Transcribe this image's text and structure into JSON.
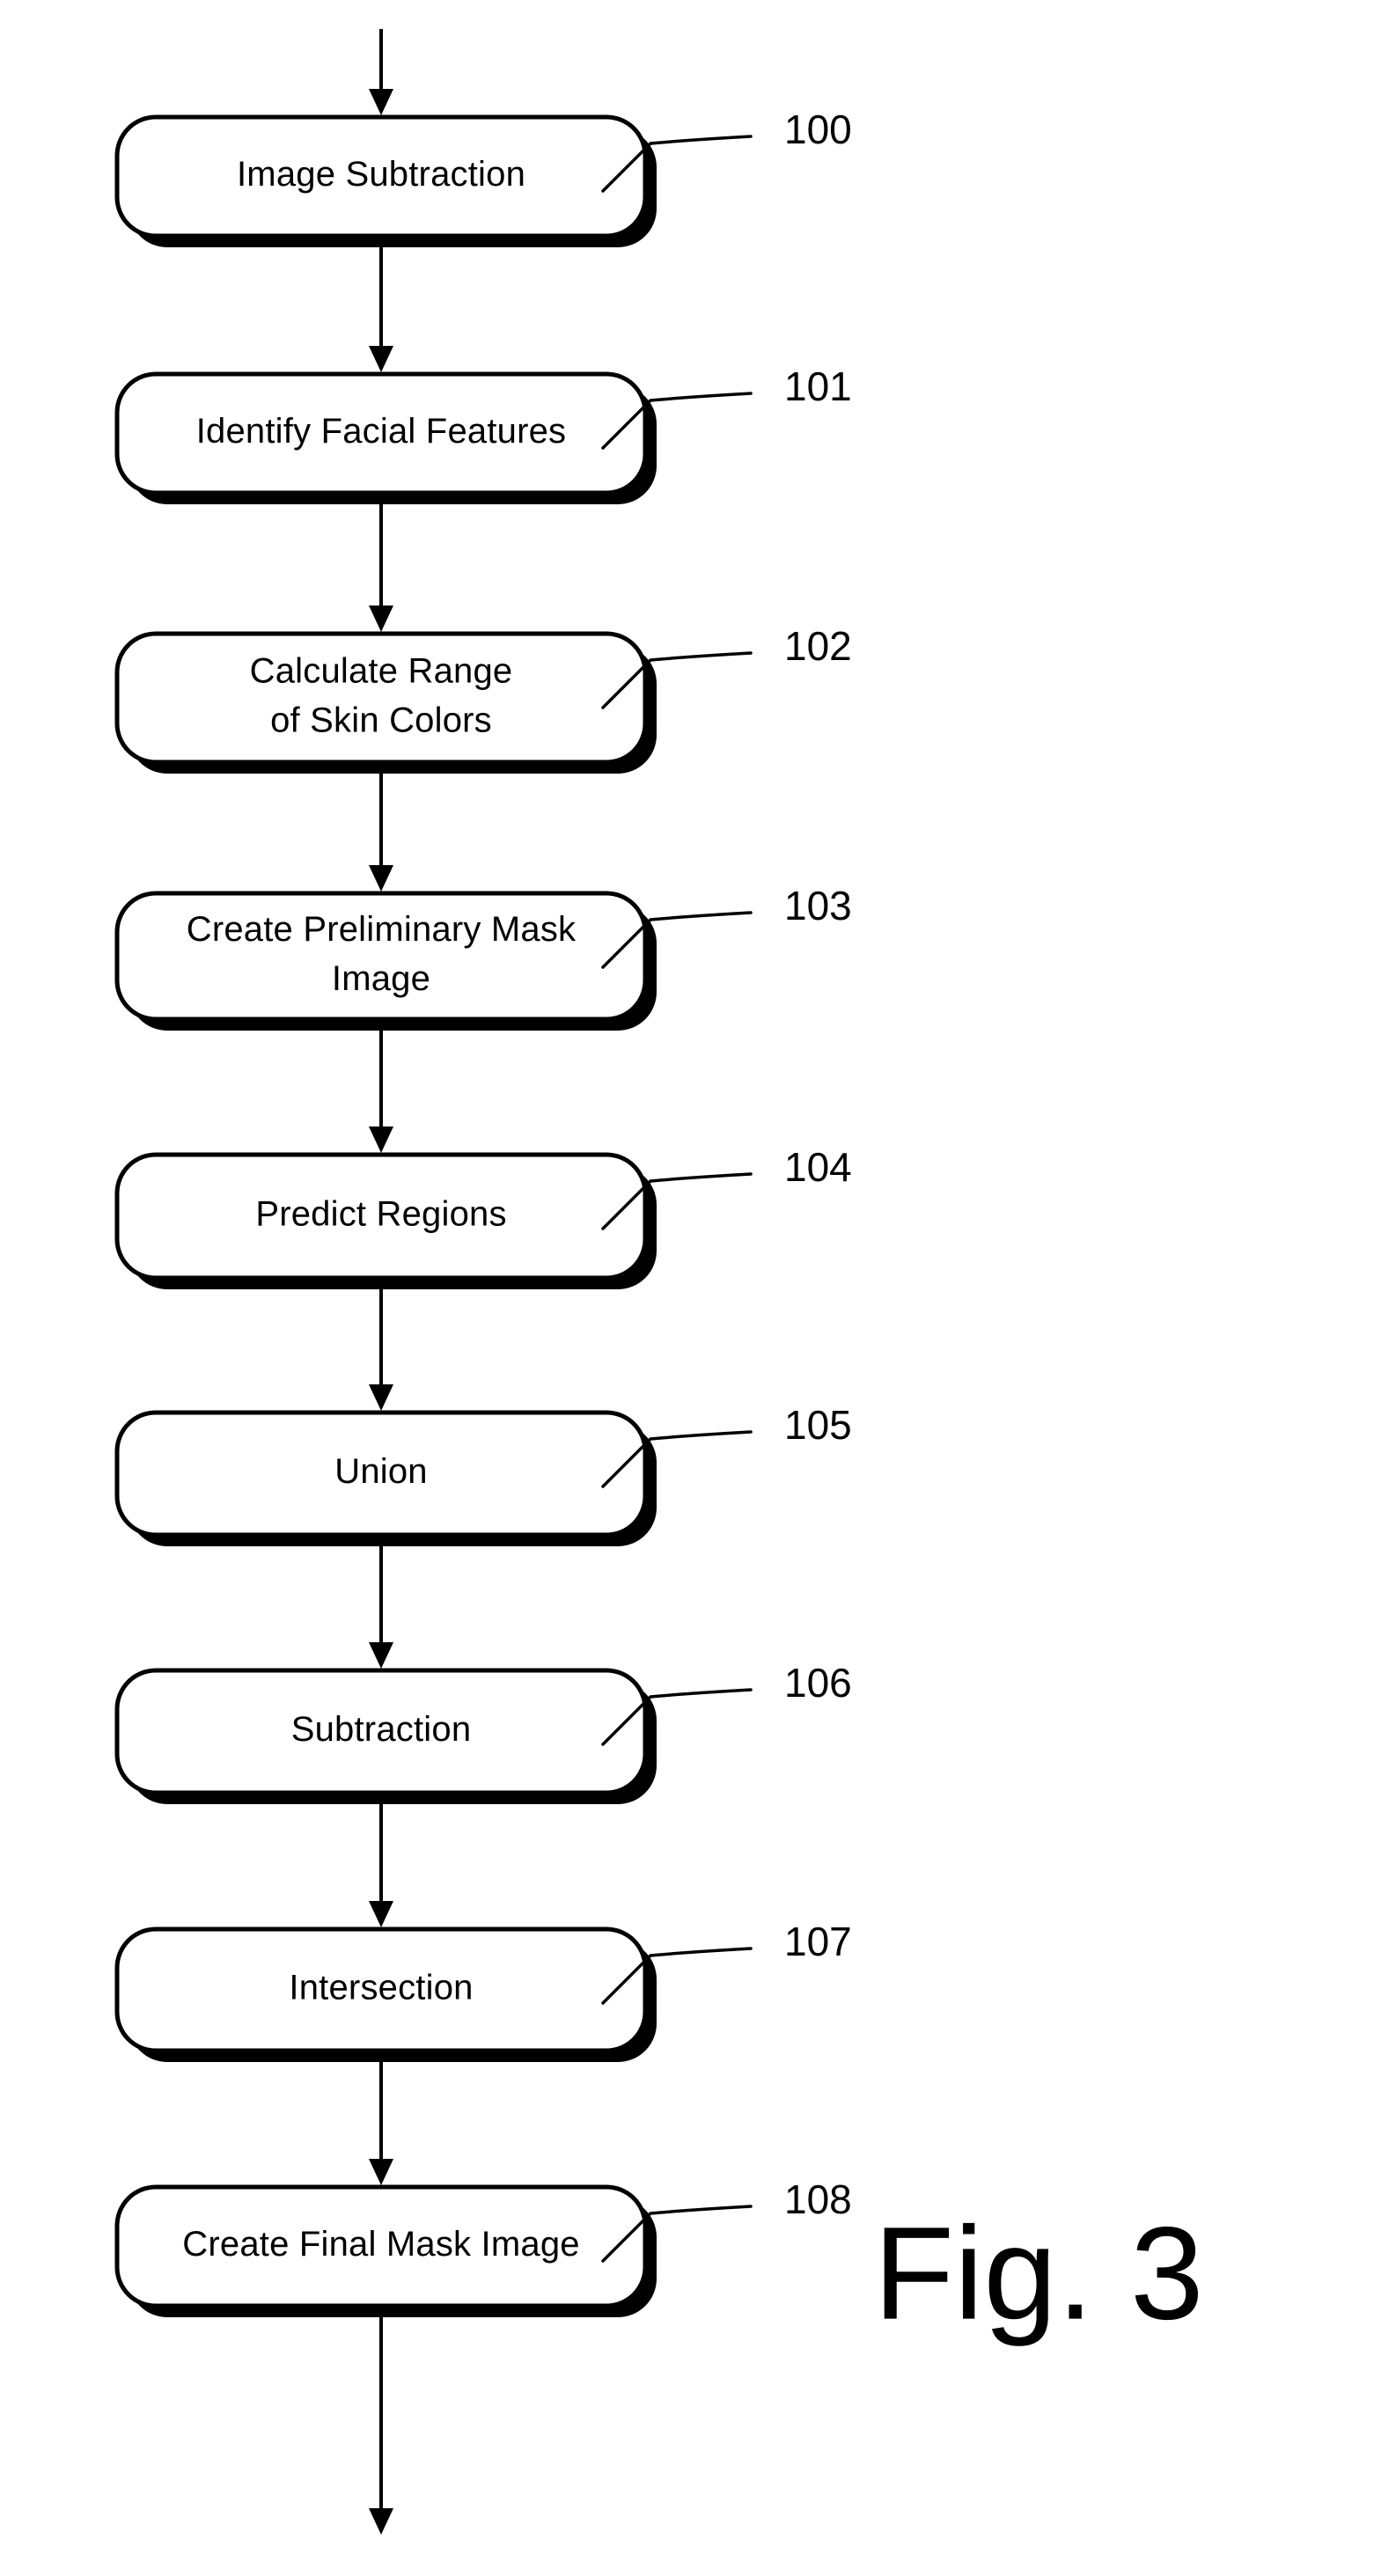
{
  "figure": {
    "caption": "Fig. 3",
    "type": "flowchart",
    "orientation": "vertical",
    "background_color": "#ffffff",
    "line_color": "#000000"
  },
  "flow": {
    "entry_arrow": true,
    "exit_arrow": true,
    "steps": [
      {
        "ref": "100",
        "lines": [
          "Image Subtraction"
        ]
      },
      {
        "ref": "101",
        "lines": [
          "Identify Facial Features"
        ]
      },
      {
        "ref": "102",
        "lines": [
          "Calculate Range",
          "of Skin Colors"
        ]
      },
      {
        "ref": "103",
        "lines": [
          "Create Preliminary Mask",
          "Image"
        ]
      },
      {
        "ref": "104",
        "lines": [
          "Predict Regions"
        ]
      },
      {
        "ref": "105",
        "lines": [
          "Union"
        ]
      },
      {
        "ref": "106",
        "lines": [
          "Subtraction"
        ]
      },
      {
        "ref": "107",
        "lines": [
          "Intersection"
        ]
      },
      {
        "ref": "108",
        "lines": [
          "Create Final Mask Image"
        ]
      }
    ]
  }
}
